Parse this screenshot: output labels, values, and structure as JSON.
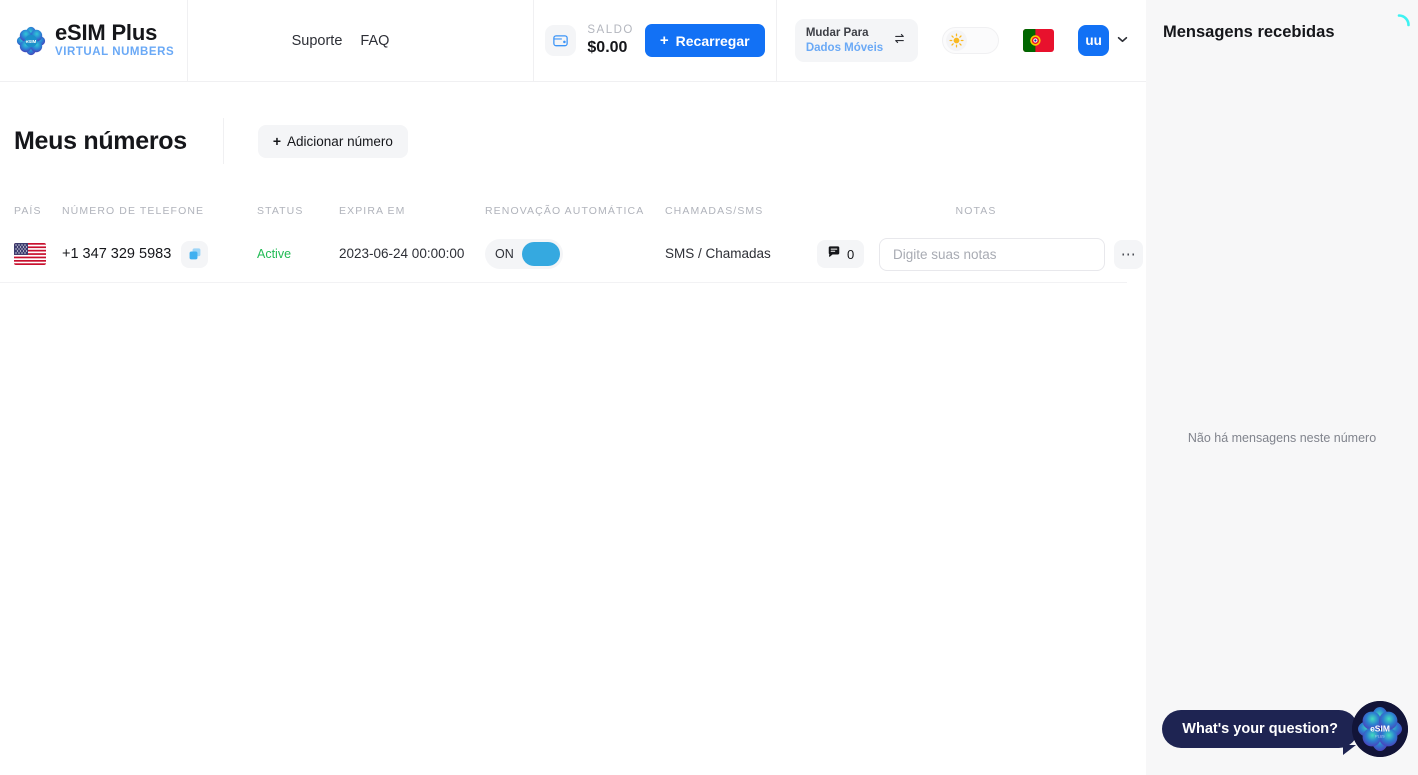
{
  "brand": {
    "name": "eSIM Plus",
    "tagline": "VIRTUAL NUMBERS",
    "logo_icon": "esim-flower-logo",
    "accent_blue": "#1271f5",
    "light_blue": "#6aa9f6"
  },
  "header": {
    "nav": [
      {
        "label": "Suporte",
        "name": "support"
      },
      {
        "label": "FAQ",
        "name": "faq"
      }
    ],
    "balance": {
      "icon": "wallet-icon",
      "label": "SALDO",
      "value": "$0.00"
    },
    "recharge_button": {
      "label": "Recarregar",
      "icon": "plus-icon"
    },
    "data_switch": {
      "line1": "Mudar Para",
      "line2": "Dados Móveis",
      "icon": "swap-arrows-icon"
    },
    "theme_toggle": {
      "icon": "sun-icon",
      "state": "light"
    },
    "language": {
      "flag": "portugal-flag",
      "name": "Portugal"
    },
    "account": {
      "initials": "uu",
      "chevron": "chevron-down-icon"
    }
  },
  "page": {
    "title": "Meus números",
    "add_button": {
      "label": "Adicionar número",
      "icon": "plus-icon"
    }
  },
  "table": {
    "columns": [
      "PAÍS",
      "NÚMERO DE TELEFONE",
      "STATUS",
      "EXPIRA EM",
      "RENOVAÇÃO AUTOMÁTICA",
      "CHAMADAS/SMS",
      "NOTAS"
    ],
    "rows": [
      {
        "country_flag": "usa-flag",
        "phone": "+1 347 329 5983",
        "copy_icon": "copy-icon",
        "status": "Active",
        "expires": "2023-06-24 00:00:00",
        "renew_label": "ON",
        "renew_on": true,
        "calls": "SMS / Chamadas",
        "messages_icon": "message-bubble-icon",
        "messages_count": "0",
        "notes_value": "",
        "notes_placeholder": "Digite suas notas",
        "more_icon": "ellipsis-icon"
      }
    ]
  },
  "messages_panel": {
    "title": "Mensagens recebidas",
    "spinner": "loading-spinner",
    "empty_text": "Não há mensagens neste número"
  },
  "chat_widget": {
    "bubble_text": "What's your question?",
    "orb_icon": "esim-orb-logo"
  }
}
